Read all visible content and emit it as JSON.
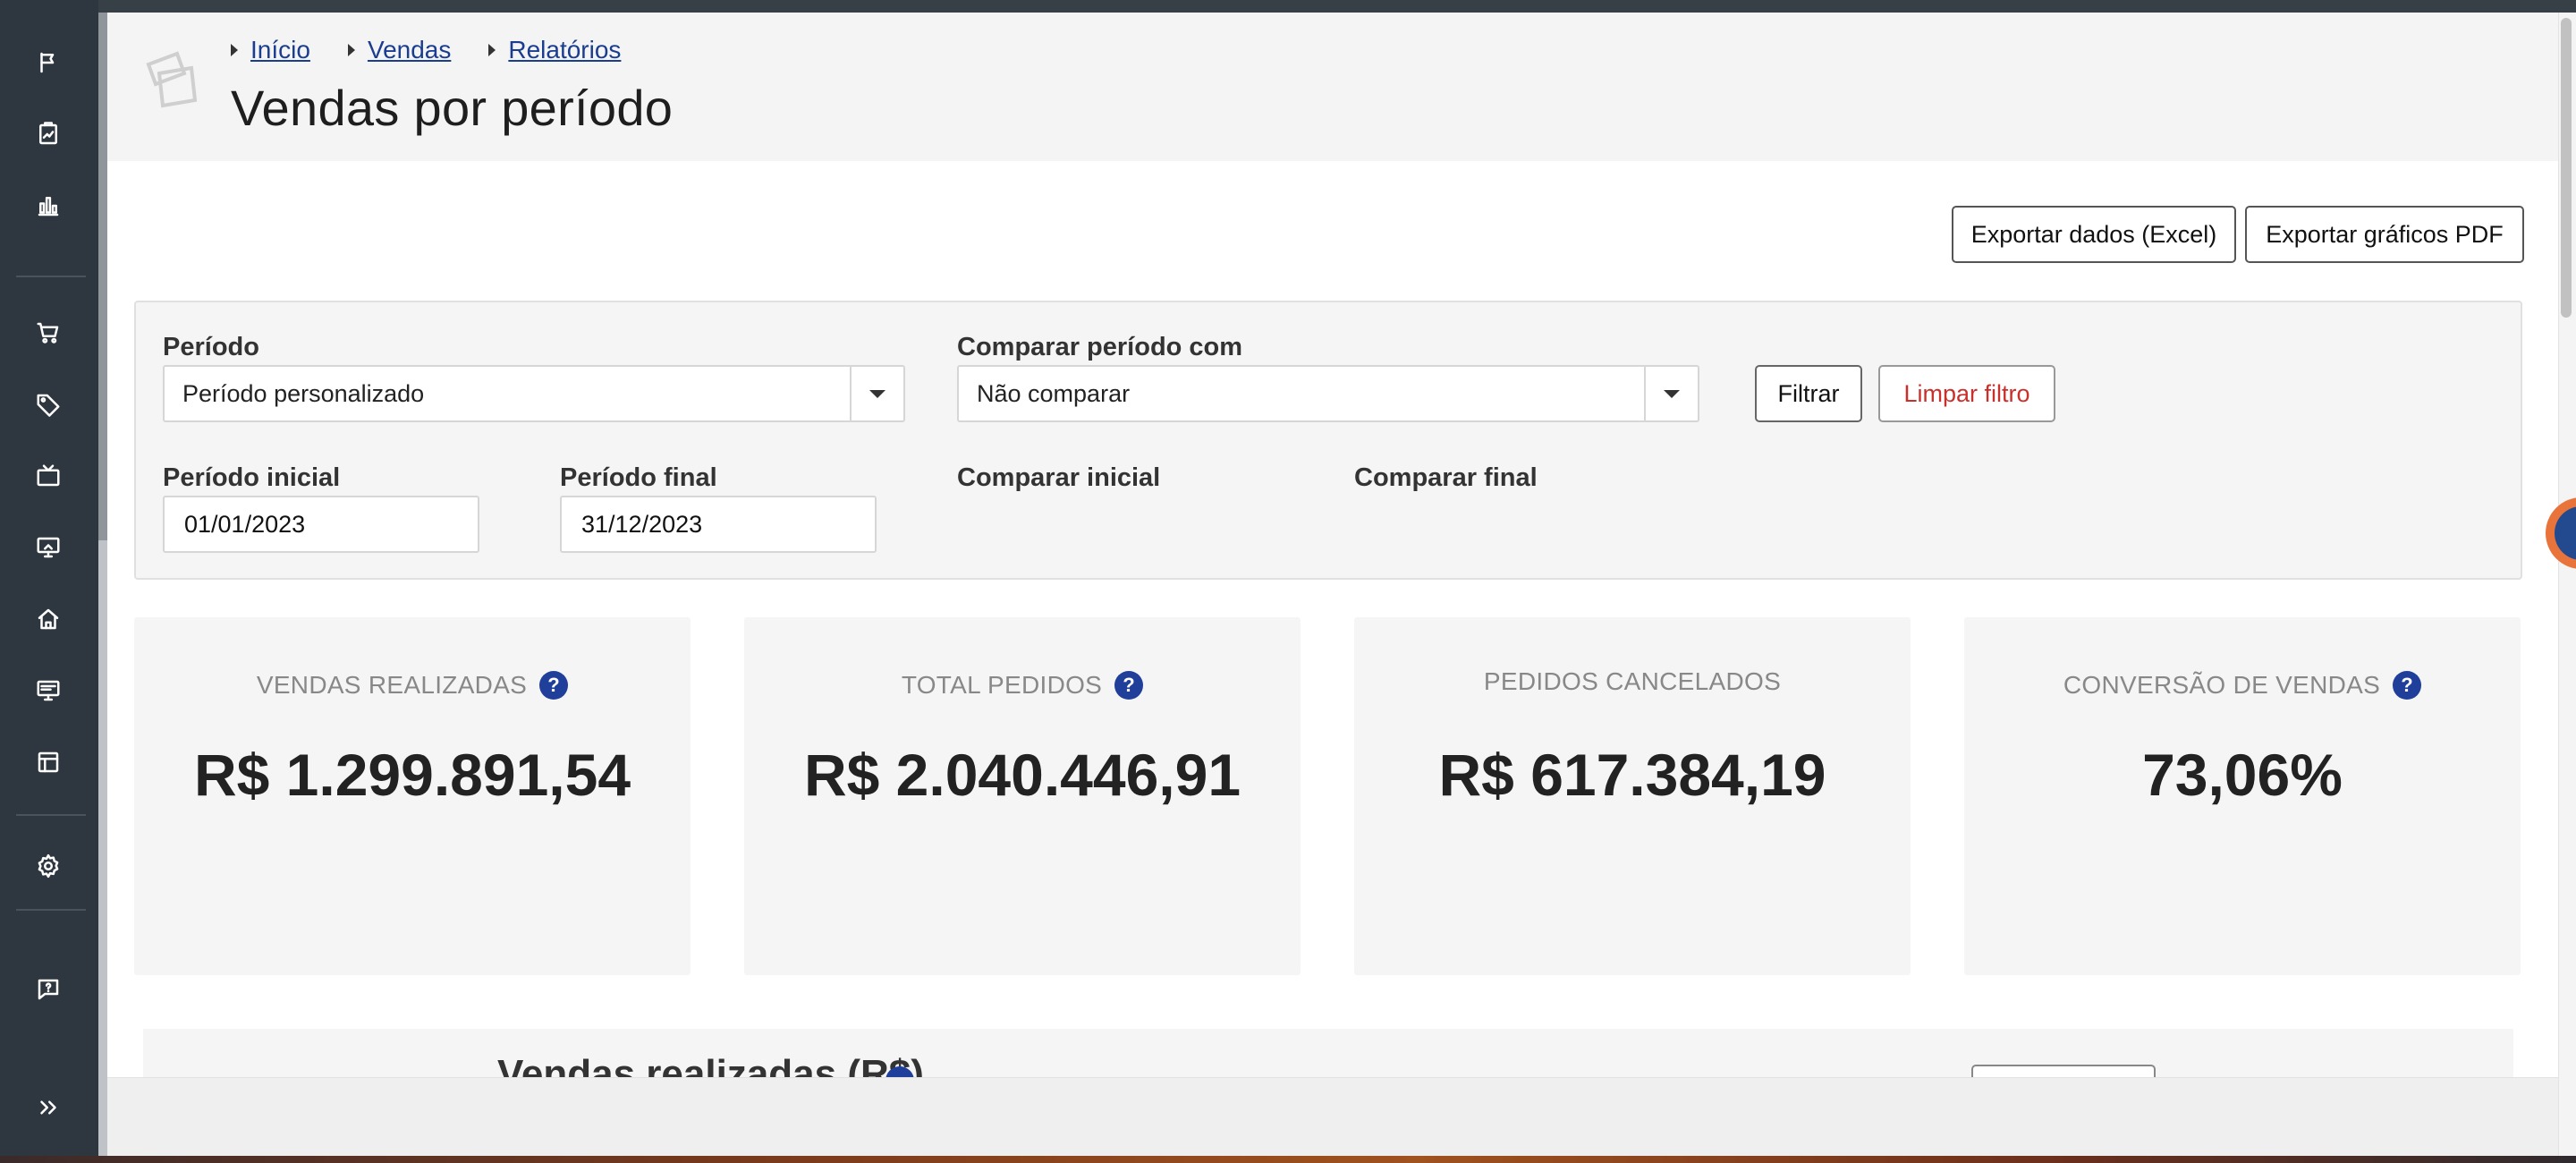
{
  "breadcrumb": [
    {
      "label": "Início"
    },
    {
      "label": "Vendas"
    },
    {
      "label": "Relatórios"
    }
  ],
  "page_title": "Vendas por período",
  "toolbar": {
    "export_excel": "Exportar dados (Excel)",
    "export_pdf": "Exportar gráficos PDF"
  },
  "filters": {
    "periodo_label": "Período",
    "periodo_value": "Período personalizado",
    "comparar_label": "Comparar período com",
    "comparar_value": "Não comparar",
    "filtrar_label": "Filtrar",
    "limpar_label": "Limpar filtro",
    "periodo_inicial_label": "Período inicial",
    "periodo_inicial_value": "01/01/2023",
    "periodo_final_label": "Período final",
    "periodo_final_value": "31/12/2023",
    "comparar_inicial_label": "Comparar inicial",
    "comparar_final_label": "Comparar final"
  },
  "kpis": [
    {
      "label": "VENDAS REALIZADAS",
      "value": "R$ 1.299.891,54",
      "help": "?"
    },
    {
      "label": "TOTAL PEDIDOS",
      "value": "R$ 2.040.446,91",
      "help": "?"
    },
    {
      "label": "PEDIDOS CANCELADOS",
      "value": "R$ 617.384,19"
    },
    {
      "label": "CONVERSÃO DE VENDAS",
      "value": "73,06%",
      "help": "?"
    }
  ],
  "chart_section": {
    "title": "Vendas realizadas (R$)"
  },
  "sidebar": {
    "icons": [
      "flag-icon",
      "report-icon",
      "bar-chart-icon",
      "cart-icon",
      "tag-icon",
      "tv-icon",
      "monitor-icon",
      "home-icon",
      "display-icon",
      "layout-icon",
      "settings-icon",
      "help-chat-icon",
      "expand-icon"
    ]
  },
  "colors": {
    "sidebar_bg": "#2e3640",
    "link": "#1a3d8f",
    "help_badge": "#1f3f9a",
    "danger_text": "#c9302c"
  }
}
